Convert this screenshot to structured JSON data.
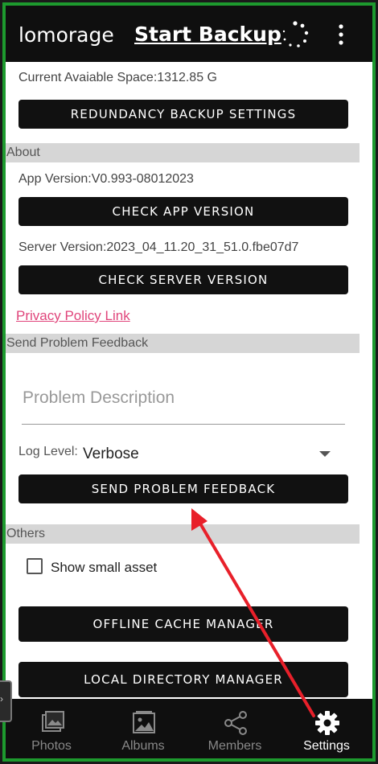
{
  "app_bar": {
    "title": "lomorage",
    "start_backup_label": "Start Backup",
    "refresh_icon": "refresh-icon",
    "menu_icon": "more-vert-icon"
  },
  "backup": {
    "available_space": "Current Avaiable Space:1312.85 G",
    "redundancy_button": "REDUNDANCY BACKUP SETTINGS"
  },
  "about": {
    "header": "About",
    "app_version": "App Version:V0.993-08012023",
    "check_app_button": "CHECK APP VERSION",
    "server_version": "Server Version:2023_04_11.20_31_51.0.fbe07d7",
    "check_server_button": "CHECK SERVER VERSION",
    "privacy_link": "Privacy Policy Link"
  },
  "feedback": {
    "header": "Send Problem Feedback",
    "description_placeholder": "Problem Description",
    "log_level_label": "Log Level:",
    "log_level_value": "Verbose",
    "send_button": "SEND PROBLEM FEEDBACK"
  },
  "others": {
    "header": "Others",
    "show_small_asset_label": "Show small asset",
    "show_small_asset_checked": false,
    "offline_cache_button": "OFFLINE CACHE MANAGER",
    "local_directory_button": "LOCAL DIRECTORY MANAGER"
  },
  "bottom_nav": {
    "items": [
      {
        "label": "Photos",
        "icon": "photos-icon"
      },
      {
        "label": "Albums",
        "icon": "albums-icon"
      },
      {
        "label": "Members",
        "icon": "share-icon"
      },
      {
        "label": "Settings",
        "icon": "gear-icon"
      }
    ],
    "active": "Settings"
  },
  "colors": {
    "frame_border": "#1d9a2e",
    "bar_background": "#0f0f0f",
    "button_background": "#111111",
    "link": "#e0457b",
    "annotation_arrow": "#e8202a"
  }
}
